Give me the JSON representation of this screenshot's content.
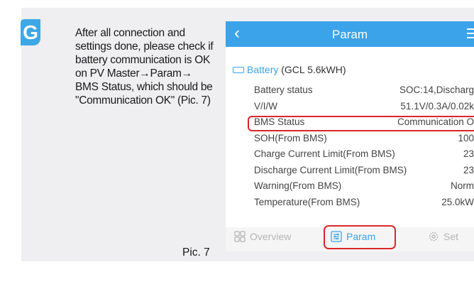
{
  "step": {
    "letter": "G"
  },
  "instruction": "After all connection and settings done, please check if battery communication is OK on PV Master→Param→ BMS Status, which should be \"Communication OK\" (Pic. 7)",
  "pic_label": "Pic. 7",
  "app": {
    "back_icon": "‹",
    "title": "Param",
    "section": {
      "prefix": "Battery",
      "model": "(GCL 5.6kWH)"
    },
    "rows": [
      {
        "label": "Battery status",
        "value": "SOC:14,Discharg"
      },
      {
        "label": "V/I/W",
        "value": "51.1V/0.3A/0.02k"
      },
      {
        "label": "BMS Status",
        "value": "Communication O"
      },
      {
        "label": "SOH(From BMS)",
        "value": "100"
      },
      {
        "label": "Charge Current Limit(From BMS)",
        "value": "23"
      },
      {
        "label": "Discharge Current Limit(From BMS)",
        "value": "23"
      },
      {
        "label": "Warning(From BMS)",
        "value": "Norm"
      },
      {
        "label": "Temperature(From BMS)",
        "value": "25.0kW"
      }
    ],
    "tabs": {
      "overview": "Overview",
      "param": "Param",
      "set": "Set"
    },
    "colors": {
      "accent": "#3aa3e9",
      "highlight": "#d9262c",
      "badge": "#3ea7e6"
    }
  }
}
